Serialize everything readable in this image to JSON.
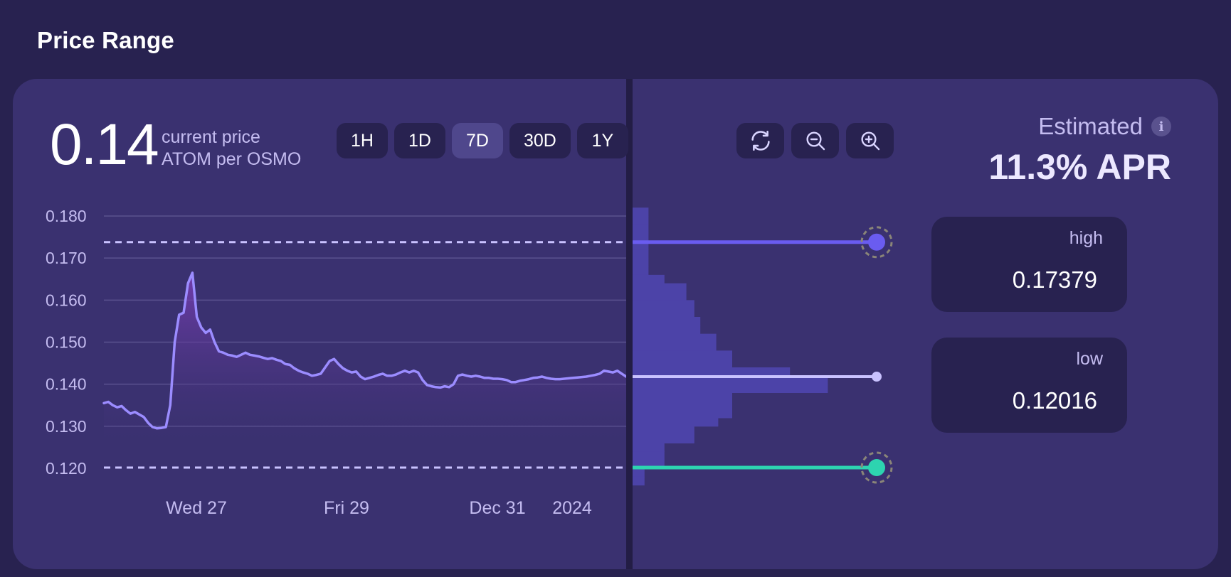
{
  "title": "Price Range",
  "price": {
    "value": "0.14",
    "label": "current price",
    "pair": "ATOM per OSMO"
  },
  "time_ranges": [
    "1H",
    "1D",
    "7D",
    "30D",
    "1Y"
  ],
  "selected_range": "7D",
  "tools": [
    "refresh-icon",
    "zoom-out-icon",
    "zoom-in-icon"
  ],
  "estimated": {
    "label": "Estimated",
    "apr": "11.3% APR"
  },
  "high": {
    "label": "high",
    "value": "0.17379"
  },
  "low": {
    "label": "low",
    "value": "0.12016"
  },
  "colors": {
    "line": "#9b8cff",
    "high_marker": "#6a5cf0",
    "low_marker": "#2dd4b0",
    "current_marker": "#c9c2ff",
    "depth_bars": "#4c43a8"
  },
  "chart_data": {
    "type": "line",
    "xlabels": [
      "Wed 27",
      "Fri 29",
      "Dec 31",
      "2024"
    ],
    "yticks": [
      "0.180",
      "0.170",
      "0.160",
      "0.150",
      "0.140",
      "0.130",
      "0.120"
    ],
    "ylim": [
      0.116,
      0.183
    ],
    "reference_lines": {
      "high": 0.17379,
      "low": 0.12016
    },
    "series": [
      {
        "values": [
          0.1355,
          0.1358,
          0.135,
          0.1345,
          0.1348,
          0.1338,
          0.133,
          0.1334,
          0.1328,
          0.1322,
          0.1308,
          0.1298,
          0.1295,
          0.1296,
          0.1298,
          0.135,
          0.15,
          0.1565,
          0.157,
          0.164,
          0.1665,
          0.156,
          0.1535,
          0.1522,
          0.153,
          0.15,
          0.1478,
          0.1475,
          0.147,
          0.1468,
          0.1465,
          0.147,
          0.1475,
          0.147,
          0.1468,
          0.1466,
          0.1463,
          0.146,
          0.1462,
          0.1458,
          0.1455,
          0.1448,
          0.1446,
          0.1438,
          0.1432,
          0.1428,
          0.1425,
          0.142,
          0.1422,
          0.1425,
          0.144,
          0.1455,
          0.146,
          0.1448,
          0.1438,
          0.1432,
          0.1428,
          0.143,
          0.1418,
          0.1412,
          0.1415,
          0.1418,
          0.1422,
          0.1425,
          0.142,
          0.142,
          0.1423,
          0.1428,
          0.1432,
          0.1428,
          0.1432,
          0.1428,
          0.141,
          0.1398,
          0.1395,
          0.1393,
          0.1392,
          0.1395,
          0.1393,
          0.14,
          0.142,
          0.1423,
          0.142,
          0.1418,
          0.142,
          0.1418,
          0.1415,
          0.1415,
          0.1413,
          0.1413,
          0.1412,
          0.141,
          0.1405,
          0.1405,
          0.1408,
          0.141,
          0.1412,
          0.1415,
          0.1416,
          0.1418,
          0.1415,
          0.1413,
          0.1412,
          0.1412,
          0.1413,
          0.1414,
          0.1415,
          0.1416,
          0.1417,
          0.1418,
          0.142,
          0.1422,
          0.1425,
          0.1432,
          0.143,
          0.1428,
          0.1432,
          0.1425,
          0.1418
        ]
      }
    ]
  },
  "depth_chart": {
    "price_bins": [
      0.181,
      0.179,
      0.177,
      0.175,
      0.173,
      0.171,
      0.169,
      0.167,
      0.165,
      0.163,
      0.161,
      0.159,
      0.157,
      0.155,
      0.153,
      0.151,
      0.149,
      0.147,
      0.145,
      0.143,
      0.141,
      0.139,
      0.137,
      0.135,
      0.133,
      0.131,
      0.129,
      0.127,
      0.125,
      0.123,
      0.121,
      0.119,
      0.117
    ],
    "liquidity": [
      0.08,
      0.08,
      0.08,
      0.08,
      0.08,
      0.08,
      0.08,
      0.08,
      0.16,
      0.27,
      0.27,
      0.31,
      0.31,
      0.34,
      0.34,
      0.42,
      0.42,
      0.5,
      0.5,
      0.79,
      0.98,
      0.98,
      0.5,
      0.5,
      0.5,
      0.43,
      0.31,
      0.31,
      0.16,
      0.16,
      0.16,
      0.06,
      0.06
    ]
  }
}
